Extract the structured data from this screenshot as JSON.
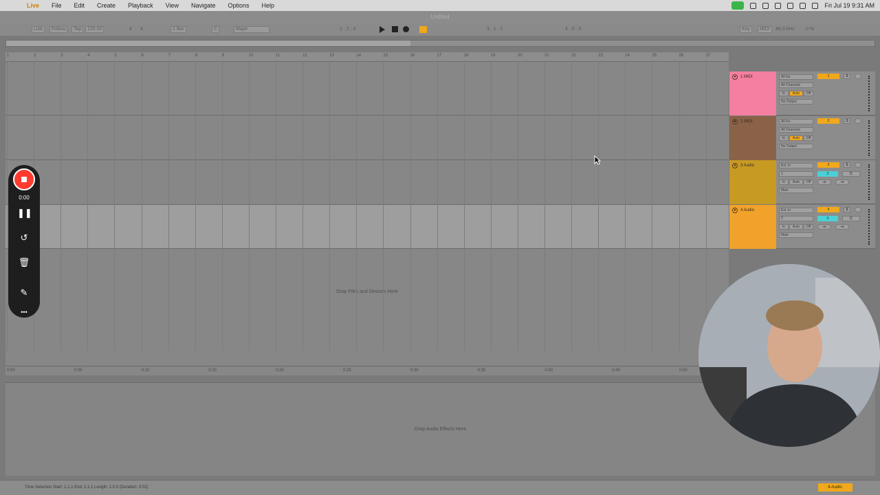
{
  "menubar": {
    "items": [
      "Live",
      "File",
      "Edit",
      "Create",
      "Playback",
      "View",
      "Navigate",
      "Options",
      "Help"
    ],
    "clock": "Fri Jul 19  9:31 AM"
  },
  "window": {
    "title": "Untitled"
  },
  "controlbar": {
    "link": "Link",
    "follow": "Follow",
    "tap": "Tap",
    "tempo": "120.00",
    "sig_num": "4",
    "sig_den": "4",
    "quant": "1 Bar",
    "key": "C",
    "scale": "Major",
    "arr_pos": "1 . 2 . 4",
    "loop_start": "3 . 1 . 1",
    "loop_len": "4 . 0 . 0",
    "key_btn": "Key",
    "midi_btn": "MIDI",
    "sample_rate": "48.0 kHz",
    "cpu": "0 %"
  },
  "ruler": {
    "bars": [
      "1",
      "2",
      "3",
      "4",
      "5",
      "6",
      "7",
      "8",
      "9",
      "10",
      "11",
      "12",
      "13",
      "14",
      "15",
      "16",
      "17",
      "18",
      "19",
      "20",
      "21",
      "22",
      "23",
      "24",
      "25",
      "26",
      "27"
    ]
  },
  "timeline": {
    "labels": [
      "0:00",
      "0:05",
      "0:10",
      "0:15",
      "0:20",
      "0:25",
      "0:30",
      "0:35",
      "0:40",
      "0:45",
      "0:50"
    ]
  },
  "arrangement": {
    "drop_hint": "Drop Files and Devices Here"
  },
  "tracks": [
    {
      "name": "1 MIDI",
      "color": "#f47fa0",
      "input": "All Ins",
      "channel": "All Channels",
      "monitor": [
        "In",
        "Auto",
        "Off"
      ],
      "output": "No Output",
      "number": "1",
      "solo": "S"
    },
    {
      "name": "2 MIDI",
      "color": "#8a6248",
      "input": "All Ins",
      "channel": "All Channels",
      "monitor": [
        "In",
        "Auto",
        "Off"
      ],
      "output": "No Output",
      "number": "2",
      "solo": "S"
    },
    {
      "name": "3 Audio",
      "color": "#c79a22",
      "input": "Ext. In",
      "channel": "1",
      "monitor": [
        "In",
        "Auto",
        "Off"
      ],
      "output": "Main",
      "number": "3",
      "solo": "S",
      "volume": "0",
      "pan": "C",
      "sends": [
        "-∞",
        "-∞"
      ]
    },
    {
      "name": "4 Audio",
      "color": "#f0a22a",
      "input": "Ext. In",
      "channel": "2",
      "monitor": [
        "In",
        "Auto",
        "Off"
      ],
      "output": "Main",
      "number": "4",
      "solo": "S",
      "volume": "0",
      "pan": "C",
      "sends": [
        "-∞",
        "-∞"
      ]
    }
  ],
  "devices": {
    "drop_hint": "Drop Audio Effects Here"
  },
  "statusbar": {
    "text": "Time Selection    Start: 1.1.1    End: 2.1.1    Length: 1.0.0  (Duration: 0:02)",
    "selected_track": "4-Audio"
  },
  "recorder": {
    "time": "0:00"
  }
}
